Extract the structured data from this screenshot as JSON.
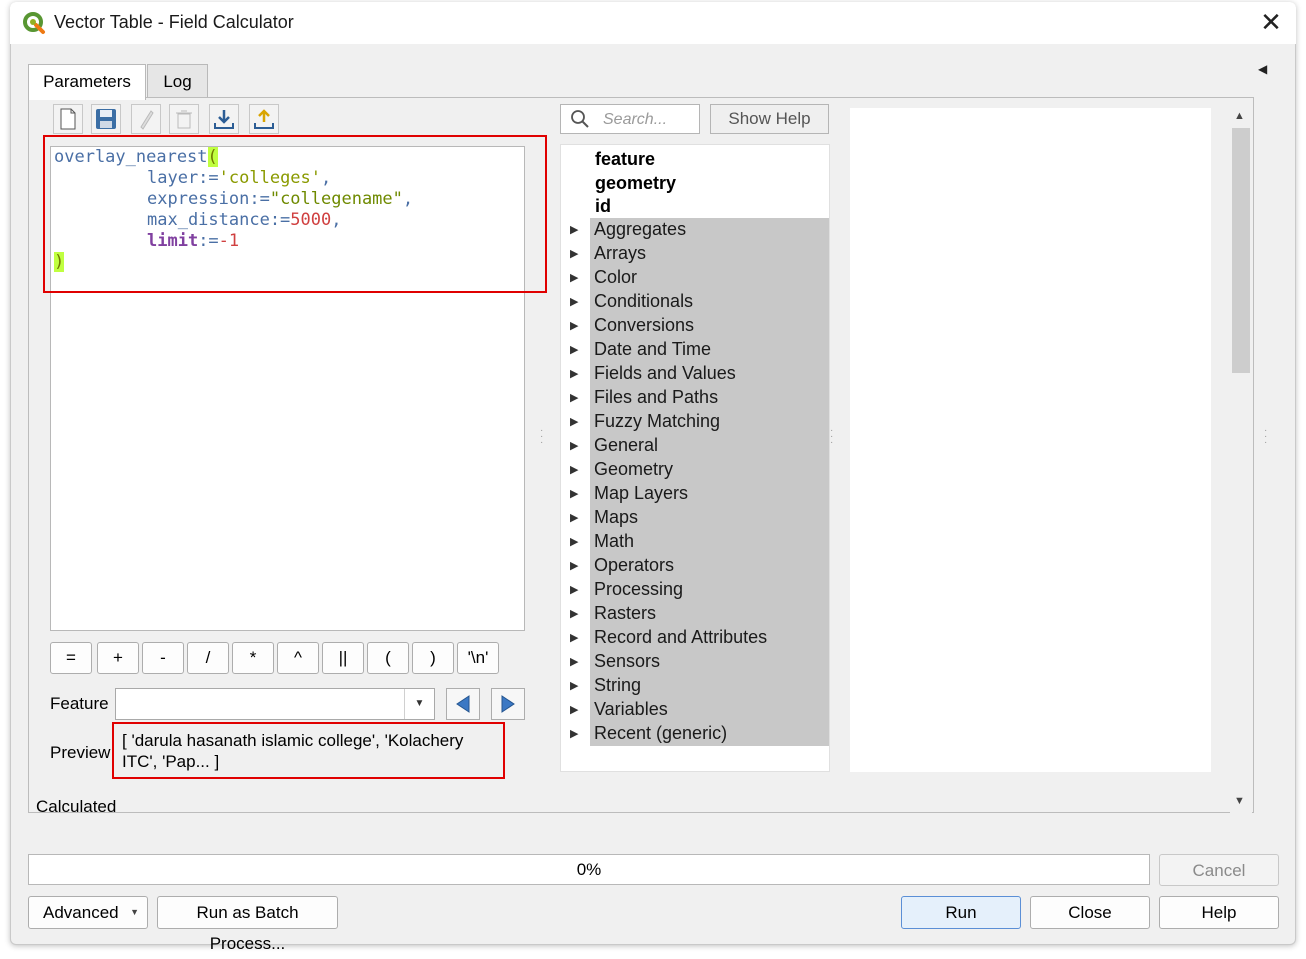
{
  "window": {
    "title": "Vector Table - Field Calculator"
  },
  "tabs": [
    {
      "label": "Parameters"
    },
    {
      "label": "Log"
    }
  ],
  "editor": {
    "lines": {
      "l1_fn": "overlay_nearest",
      "l1_paren": "(",
      "l2_key": "layer:=",
      "l2_val": "'colleges'",
      "l2_comma": ",",
      "l3_key": "expression:=",
      "l3_val": "\"collegename\"",
      "l3_comma": ",",
      "l4_key": "max_distance:=",
      "l4_val": "5000",
      "l4_comma": ",",
      "l5_key": "limit",
      "l5_op": ":=",
      "l5_val": "-1",
      "l6_paren": ")"
    }
  },
  "operators": [
    "=",
    "+",
    "-",
    "/",
    "*",
    "^",
    "||",
    "(",
    ")",
    "'\\n'"
  ],
  "feature": {
    "label": "Feature",
    "value": ""
  },
  "preview": {
    "label": "Preview:",
    "text": "[ 'darula hasanath islamic college', 'Kolachery ITC', 'Pap... ]"
  },
  "calculated_label": "Calculated",
  "search": {
    "placeholder": "Search..."
  },
  "show_help_label": "Show Help",
  "tree": {
    "top_items": [
      "feature",
      "geometry",
      "id"
    ],
    "groups": [
      "Aggregates",
      "Arrays",
      "Color",
      "Conditionals",
      "Conversions",
      "Date and Time",
      "Fields and Values",
      "Files and Paths",
      "Fuzzy Matching",
      "General",
      "Geometry",
      "Map Layers",
      "Maps",
      "Math",
      "Operators",
      "Processing",
      "Rasters",
      "Record and Attributes",
      "Sensors",
      "String",
      "Variables",
      "Recent (generic)"
    ]
  },
  "progress": {
    "value": 0,
    "text": "0%"
  },
  "buttons": {
    "cancel": "Cancel",
    "advanced": "Advanced",
    "batch": "Run as Batch Process...",
    "run": "Run",
    "close": "Close",
    "help": "Help"
  },
  "colors": {
    "highlight_box": "#e00000",
    "paren_highlight": "#c0ff40",
    "tree_group_bg": "#c8c8c8"
  }
}
